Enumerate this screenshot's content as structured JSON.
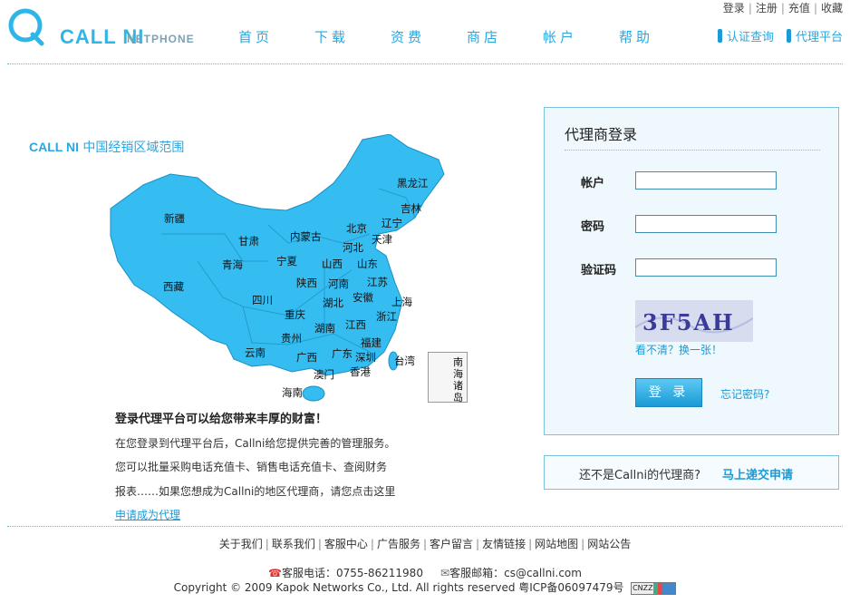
{
  "header": {
    "brand": "CALL NI",
    "brand_sub": "NETPHONE",
    "nav": [
      "首页",
      "下载",
      "资费",
      "商店",
      "帐户",
      "帮助"
    ],
    "toplinks": [
      "登录",
      "注册",
      "充值",
      "收藏"
    ],
    "sublinks": [
      "认证查询",
      "代理平台"
    ]
  },
  "map": {
    "title_brand": "CALL NI",
    "title": "中国经销区域范围",
    "inset_label": [
      "南",
      "海",
      "诸",
      "岛"
    ],
    "fill_color": "#35bcf0",
    "provinces": [
      "黑龙江",
      "吉林",
      "辽宁",
      "新疆",
      "内蒙古",
      "北京",
      "天津",
      "甘肃",
      "河北",
      "青海",
      "宁夏",
      "山西",
      "山东",
      "西藏",
      "陕西",
      "河南",
      "江苏",
      "四川",
      "湖北",
      "安徽",
      "上海",
      "重庆",
      "浙江",
      "湖南",
      "江西",
      "贵州",
      "福建",
      "云南",
      "广西",
      "广东",
      "深圳",
      "台湾",
      "澳门",
      "香港",
      "海南"
    ]
  },
  "intro": {
    "heading": "登录代理平台可以给您带来丰厚的财富！",
    "lines": [
      "在您登录到代理平台后，Callni给您提供完善的管理服务。",
      "您可以批量采购电话充值卡、销售电话充值卡、查阅财务",
      "报表……如果您想成为Callni的地区代理商，请您点击这里"
    ],
    "link": "申请成为代理"
  },
  "login": {
    "title": "代理商登录",
    "account_label": "帐户",
    "password_label": "密码",
    "captcha_label": "验证码",
    "captcha_text": "3F5AH",
    "refresh": "看不清？换一张！",
    "submit": "登 录",
    "forgot": "忘记密码?"
  },
  "apply": {
    "question": "还不是Callni的代理商?",
    "link": "马上递交申请"
  },
  "footer": {
    "links": [
      "关于我们",
      "联系我们",
      "客服中心",
      "广告服务",
      "客户留言",
      "友情链接",
      "网站地图",
      "网站公告"
    ],
    "phone": "客服电话：0755-86211980",
    "email": "客服邮箱：cs@callni.com",
    "copyright": "Copyright © 2009 Kapok Networks Co., Ltd. All rights reserved 粤ICP备06097479号",
    "badge": "CNZZ"
  }
}
